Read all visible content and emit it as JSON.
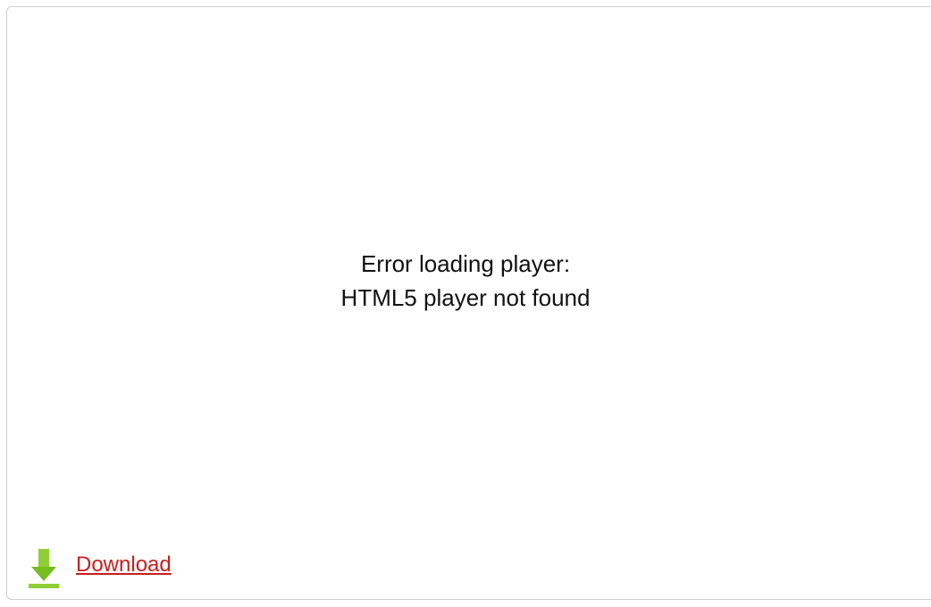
{
  "player": {
    "error_title": "Error loading player:",
    "error_detail": "HTML5 player not found"
  },
  "download": {
    "label": "Download",
    "icon": "download-arrow-icon",
    "icon_color": "#76bd22",
    "link_color": "#c81e1e"
  }
}
